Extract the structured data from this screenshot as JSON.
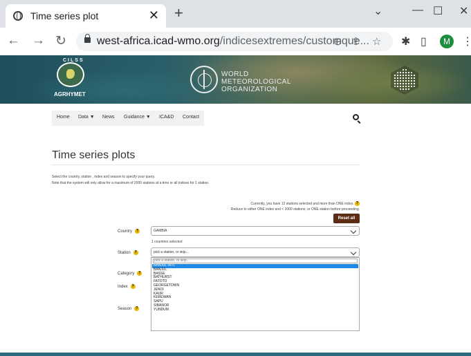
{
  "browser": {
    "tab_title": "Time series plot",
    "tab_close": "✕",
    "new_tab": "+",
    "url_host": "west-africa.icad-wmo.org",
    "url_path": "/indicesextremes/customque...",
    "profile_initial": "M",
    "window_minimize": "—",
    "window_maximize": "☐",
    "window_close": "✕",
    "tab_search": "⌄"
  },
  "banner": {
    "left_logo_arc": "CILSS",
    "left_logo_text": "AGRHYMET",
    "wmo_line1": "WORLD",
    "wmo_line2": "METEOROLOGICAL",
    "wmo_line3": "ORGANIZATION"
  },
  "nav": {
    "items": [
      "Home",
      "Data ▼",
      "News",
      "Guidance ▼",
      "ICA&D",
      "Contact"
    ]
  },
  "page": {
    "title": "Time series plots",
    "intro_line1": "Select the country, station , index and season to specify your query.",
    "intro_line2": "Note that the system will only allow for a maximum of 2000 stations at a time or all indices for 1 station.",
    "notice_line1": "Currently, you have 12 stations selected and more than ONE index.",
    "notice_line2": "Reduce to either ONE index and < 2000 stations, or ONE station before proceeding.",
    "reset_label": "Reset all",
    "help_glyph": "?"
  },
  "form": {
    "country_label": "Country",
    "country_value": "GAMBIA",
    "country_count": "1 countries selected",
    "station_label": "Station",
    "station_placeholder": "pick a station, or skip...",
    "category_label": "Category",
    "index_label": "Index",
    "season_label": "Season",
    "dropdown_search": "pick a station, or skip...",
    "stations": [
      "BANJUL INTL",
      "BANJUL",
      "BASSE",
      "BATHURST",
      "FATOTO",
      "GEORGETOWN",
      "JENOI",
      "KAUR",
      "KEREWAN",
      "SAPU",
      "SIBANOR",
      "YUNDUM"
    ],
    "highlighted_station_index": 0
  },
  "colors": {
    "accent_brown": "#5a2d14",
    "highlight_blue": "#1e88e5",
    "help_yellow": "#e6b800",
    "footer_teal": "#2e6a80"
  }
}
